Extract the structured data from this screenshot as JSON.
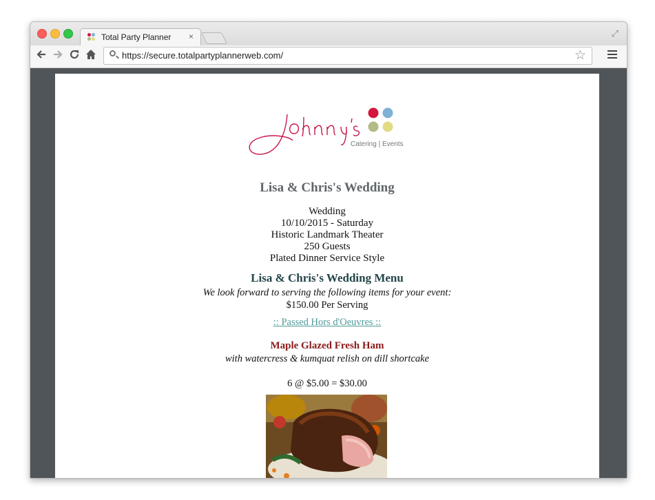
{
  "browser": {
    "tab_title": "Total Party Planner",
    "tab_close": "×",
    "url": "https://secure.totalpartyplannerweb.com/",
    "nav_icons": [
      "back-arrow-icon",
      "forward-arrow-icon",
      "reload-icon",
      "home-icon"
    ],
    "star_glyph": "☆",
    "fullscreen_glyph": "⤢"
  },
  "logo": {
    "script_text": "Johnny's",
    "tagline": "Catering | Events",
    "dot_colors": [
      "#d4163f",
      "#7fb1d3",
      "#b1bb86",
      "#e2db85"
    ]
  },
  "event": {
    "title": "Lisa & Chris's Wedding",
    "details": [
      "Wedding",
      "10/10/2015 - Saturday",
      "Historic Landmark Theater",
      "250 Guests",
      "Plated Dinner Service Style"
    ]
  },
  "menu": {
    "title": "Lisa & Chris's Wedding Menu",
    "intro": "We look forward to serving the following items for your event:",
    "price": "$150.00 Per Serving",
    "section_link": ":: Passed Hors d'Oeuvres ::"
  },
  "item": {
    "name": "Maple Glazed Fresh Ham",
    "description": "with watercress & kumquat relish on dill shortcake",
    "calculation": "6 @ $5.00 = $30.00"
  }
}
